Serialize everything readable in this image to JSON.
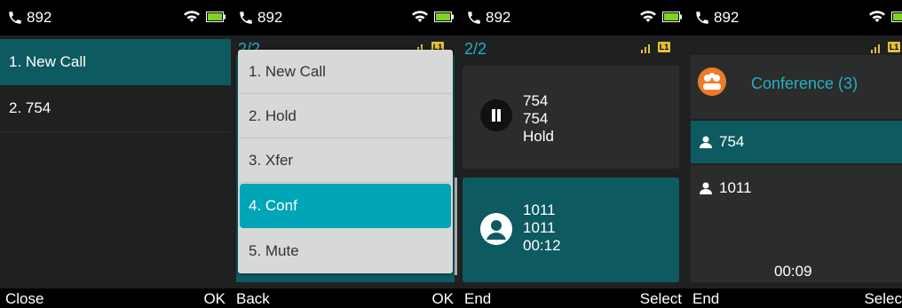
{
  "screens": [
    {
      "status": {
        "number": "892"
      },
      "list": [
        {
          "label": "1. New Call"
        },
        {
          "label": "2. 754"
        }
      ],
      "softkeys": {
        "left": "Close",
        "right": "OK"
      }
    },
    {
      "status": {
        "number": "892"
      },
      "counter": "2/2",
      "line_badge": "L1",
      "menu": [
        {
          "label": "1. New Call"
        },
        {
          "label": "2. Hold"
        },
        {
          "label": "3. Xfer"
        },
        {
          "label": "4. Conf"
        },
        {
          "label": "5. Mute"
        }
      ],
      "softkeys": {
        "left": "Back",
        "right": "OK"
      }
    },
    {
      "status": {
        "number": "892"
      },
      "counter": "2/2",
      "line_badge": "L1",
      "held_call": {
        "name": "754",
        "number": "754",
        "state": "Hold"
      },
      "active_call": {
        "name": "1011",
        "number": "1011",
        "duration": "00:12"
      },
      "softkeys": {
        "left": "End",
        "right": "Select"
      }
    },
    {
      "status": {
        "number": "892"
      },
      "line_badge": "L1",
      "conference": {
        "title": "Conference (3)",
        "members": [
          "754",
          "1011"
        ],
        "duration": "00:09"
      },
      "softkeys": {
        "left": "End",
        "right": "Selec"
      }
    }
  ],
  "colors": {
    "accent": "#00a5b7",
    "selected": "#0d5a60",
    "conf_icon": "#f07a29",
    "line_badge": "#e3c03b"
  },
  "icons": [
    "handset-icon",
    "wifi-icon",
    "battery-icon",
    "signal-icon",
    "pause-icon",
    "avatar-icon",
    "conference-icon",
    "person-icon"
  ]
}
